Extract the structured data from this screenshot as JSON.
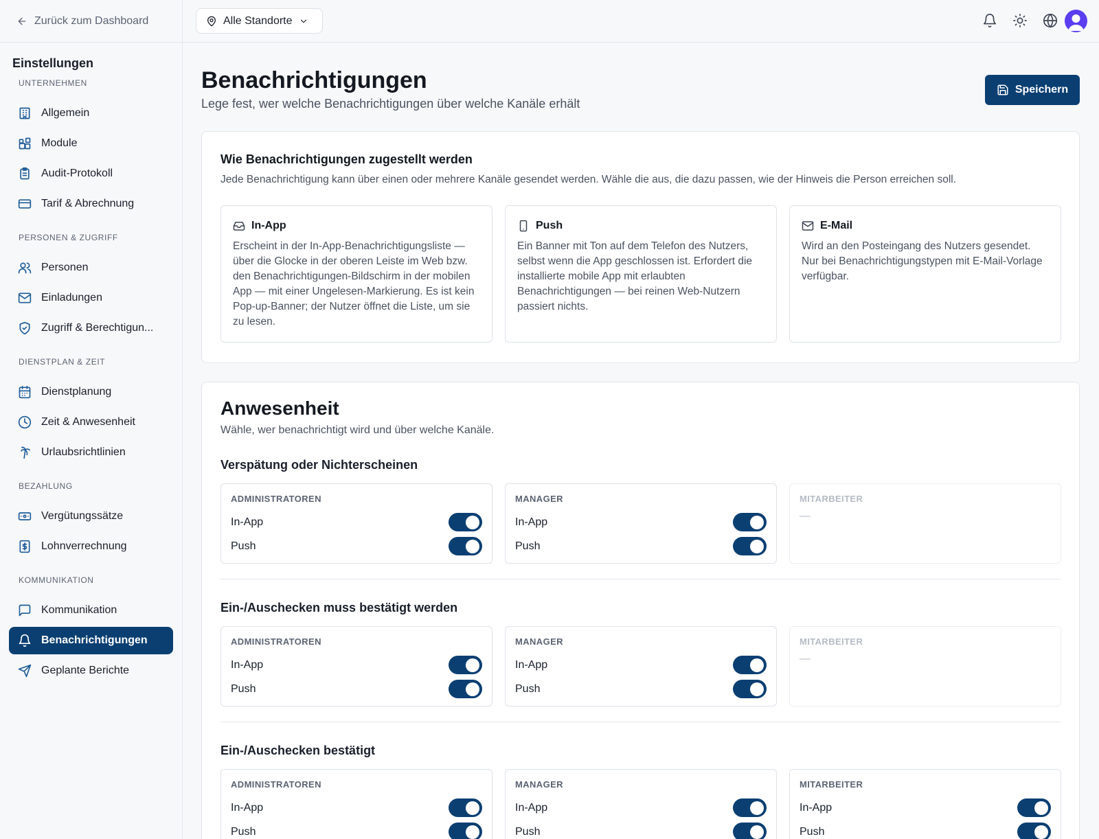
{
  "sidebar": {
    "back_label": "Zurück zum Dashboard",
    "title": "Einstellungen",
    "groups": [
      {
        "label": "UNTERNEHMEN",
        "items": [
          {
            "label": "Allgemein",
            "icon": "building-icon"
          },
          {
            "label": "Module",
            "icon": "modules-icon"
          },
          {
            "label": "Audit-Protokoll",
            "icon": "clipboard-icon"
          },
          {
            "label": "Tarif & Abrechnung",
            "icon": "credit-card-icon"
          }
        ]
      },
      {
        "label": "PERSONEN & ZUGRIFF",
        "items": [
          {
            "label": "Personen",
            "icon": "users-icon"
          },
          {
            "label": "Einladungen",
            "icon": "mail-icon"
          },
          {
            "label": "Zugriff & Berechtigun...",
            "icon": "shield-icon"
          }
        ]
      },
      {
        "label": "DIENSTPLAN & ZEIT",
        "items": [
          {
            "label": "Dienstplanung",
            "icon": "calendar-icon"
          },
          {
            "label": "Zeit & Anwesenheit",
            "icon": "clock-icon"
          },
          {
            "label": "Urlaubsrichtlinien",
            "icon": "palm-tree-icon"
          }
        ]
      },
      {
        "label": "BEZAHLUNG",
        "items": [
          {
            "label": "Vergütungssätze",
            "icon": "banknote-icon"
          },
          {
            "label": "Lohnverrechnung",
            "icon": "receipt-icon"
          }
        ]
      },
      {
        "label": "KOMMUNIKATION",
        "items": [
          {
            "label": "Kommunikation",
            "icon": "message-icon"
          },
          {
            "label": "Benachrichtigungen",
            "icon": "bell-icon",
            "active": true
          },
          {
            "label": "Geplante Berichte",
            "icon": "send-icon"
          }
        ]
      }
    ]
  },
  "topbar": {
    "location_label": "Alle Standorte"
  },
  "page": {
    "title": "Benachrichtigungen",
    "subtitle": "Lege fest, wer welche Benachrichtigungen über welche Kanäle erhält",
    "save_label": "Speichern"
  },
  "delivery": {
    "title": "Wie Benachrichtigungen zugestellt werden",
    "description": "Jede Benachrichtigung kann über einen oder mehrere Kanäle gesendet werden. Wähle die aus, die dazu passen, wie der Hinweis die Person erreichen soll.",
    "channels": [
      {
        "title": "In-App",
        "icon": "inbox-icon",
        "body": "Erscheint in der In-App-Benachrichtigungsliste — über die Glocke in der oberen Leiste im Web bzw. den Benachrichtigungen-Bildschirm in der mobilen App — mit einer Ungelesen-Markierung. Es ist kein Pop-up-Banner; der Nutzer öffnet die Liste, um sie zu lesen."
      },
      {
        "title": "Push",
        "icon": "smartphone-icon",
        "body": "Ein Banner mit Ton auf dem Telefon des Nutzers, selbst wenn die App geschlossen ist. Erfordert die installierte mobile App mit erlaubten Benachrichtigungen — bei reinen Web-Nutzern passiert nichts."
      },
      {
        "title": "E-Mail",
        "icon": "mail-icon",
        "body": "Wird an den Posteingang des Nutzers gesendet. Nur bei Benachrichtigungstypen mit E-Mail-Vorlage verfügbar."
      }
    ]
  },
  "attendance": {
    "title": "Anwesenheit",
    "subtitle": "Wähle, wer benachrichtigt wird und über welche Kanäle.",
    "groups": [
      {
        "title": "Verspätung oder Nichterscheinen",
        "roles": [
          {
            "name": "ADMINISTRATOREN",
            "rows": [
              {
                "label": "In-App",
                "on": true
              },
              {
                "label": "Push",
                "on": true
              }
            ]
          },
          {
            "name": "MANAGER",
            "rows": [
              {
                "label": "In-App",
                "on": true
              },
              {
                "label": "Push",
                "on": true
              }
            ]
          },
          {
            "name": "MITARBEITER",
            "empty": "—"
          }
        ]
      },
      {
        "title": "Ein-/Auschecken muss bestätigt werden",
        "roles": [
          {
            "name": "ADMINISTRATOREN",
            "rows": [
              {
                "label": "In-App",
                "on": true
              },
              {
                "label": "Push",
                "on": true
              }
            ]
          },
          {
            "name": "MANAGER",
            "rows": [
              {
                "label": "In-App",
                "on": true
              },
              {
                "label": "Push",
                "on": true
              }
            ]
          },
          {
            "name": "MITARBEITER",
            "empty": "—"
          }
        ]
      },
      {
        "title": "Ein-/Auschecken bestätigt",
        "roles": [
          {
            "name": "ADMINISTRATOREN",
            "rows": [
              {
                "label": "In-App",
                "on": true
              },
              {
                "label": "Push",
                "on": true
              }
            ]
          },
          {
            "name": "MANAGER",
            "rows": [
              {
                "label": "In-App",
                "on": true
              },
              {
                "label": "Push",
                "on": true
              }
            ]
          },
          {
            "name": "MITARBEITER",
            "rows": [
              {
                "label": "In-App",
                "on": true
              },
              {
                "label": "Push",
                "on": true
              }
            ]
          }
        ]
      }
    ]
  },
  "colors": {
    "accent": "#0b3f72",
    "avatar": "#5b3ef0"
  }
}
